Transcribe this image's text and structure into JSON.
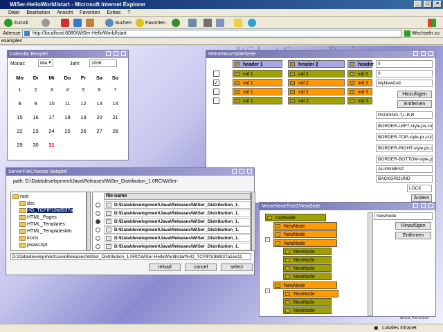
{
  "browser": {
    "title": "WiSer-HelloWorld/start - Microsoft Internet Explorer",
    "menu": [
      "Datei",
      "Bearbeiten",
      "Ansicht",
      "Favoriten",
      "Extras",
      "?"
    ],
    "toolbar": {
      "back": "Zurück",
      "search": "Suchen",
      "favorites": "Favoriten"
    },
    "address_label": "Adresse",
    "url": "http://localhost:8080/WiSer-HelloWorld/start",
    "go_label": "Wechseln zu",
    "links_text": "examples",
    "status_text": "Lokales Intranet",
    "watermark": "Widget Server Project",
    "watermark_small": "Beta Release"
  },
  "calendar": {
    "title": "Calendar Beispiel",
    "month_label": "Monat:",
    "month_value": "Mai",
    "year_label": "Jahr:",
    "year_value": "2006",
    "weekdays": [
      "Mo",
      "Di",
      "Mi",
      "Do",
      "Fr",
      "Sa",
      "So"
    ],
    "weeks": [
      [
        "1",
        "2",
        "3",
        "4",
        "5",
        "6",
        "7"
      ],
      [
        "8",
        "9",
        "10",
        "11",
        "12",
        "13",
        "14"
      ],
      [
        "15",
        "16",
        "17",
        "18",
        "19",
        "20",
        "21"
      ],
      [
        "22",
        "23",
        "24",
        "25",
        "26",
        "27",
        "28"
      ],
      [
        "29",
        "30",
        "31",
        "",
        "",
        "",
        ""
      ]
    ],
    "highlight_day": "31"
  },
  "table": {
    "title": "MeineNeueTableSeite",
    "headers": [
      "header 1",
      "header 2",
      "header 3"
    ],
    "rows": [
      {
        "checked": false,
        "cells": [
          "val 1",
          "val 2",
          "val 3"
        ]
      },
      {
        "checked": true,
        "cells": [
          "val 1",
          "val 2",
          "val 3"
        ]
      },
      {
        "checked": false,
        "cells": [
          "val 1",
          "val 2",
          "val 3"
        ]
      },
      {
        "checked": false,
        "cells": [
          "val 1",
          "val 2",
          "val 3"
        ]
      }
    ],
    "side_inputs": [
      "0",
      "0",
      "MyNewCell"
    ],
    "add_label": "Hinzufügen",
    "remove_label": "Entfernen",
    "style_inputs": [
      "PADDING-T,L,B,R",
      "BORDER-LEFT-style,px,co",
      "BORDER-TOP-style,px,col",
      "BORDER-RIGHT-style,px,c",
      "BORDER-BOTTOM-style,p"
    ],
    "align_inputs": [
      "ALIGNMENT",
      "BACKGROUND"
    ],
    "lock_value": "LOCK",
    "change_label": "Ändern"
  },
  "filechooser": {
    "title": "ServerFileChooser Beispiel",
    "path_label": "path: D:\\Data\\development\\Java\\Releases\\WiSer_Distribution_1.0RC\\WiSer-",
    "tree": [
      "root",
      "doc",
      "HO_TCPIP10b8937a",
      "HTML_Pages",
      "HTML_Templates",
      "HTML_TemplatesMo",
      "icons",
      "javascript"
    ],
    "column_header": "file name",
    "files": [
      "D:\\Data\\development\\Java\\Releases\\WiSer_Distribution_1.",
      "D:\\Data\\development\\Java\\Releases\\WiSer_Distribution_1.",
      "D:\\Data\\development\\Java\\Releases\\WiSer_Distribution_1.",
      "D:\\Data\\development\\Java\\Releases\\WiSer_Distribution_1.",
      "D:\\Data\\development\\Java\\Releases\\WiSer_Distribution_1.",
      "D:\\Data\\development\\Java\\Releases\\WiSer_Distribution_1."
    ],
    "selected_file": "D:\\Data\\development\\Java\\Releases\\WiSer_Distribution_1.0RC\\WiSer-HelloWorld\\start\\HO_TCPIP10b8937a1ee11",
    "reload_label": "reload",
    "cancel_label": "cancel",
    "select_label": "select"
  },
  "tree": {
    "title": "MeineNeueTree2ViewSeite",
    "root": "rootNode",
    "new_node": "NewNode",
    "input_value": "NewNode",
    "add_label": "Hinzufügen",
    "remove_label": "Entfernen"
  },
  "colors": {
    "orange": "#ff9a00",
    "olive": "#a0a000",
    "header": "#a8a8e8"
  }
}
